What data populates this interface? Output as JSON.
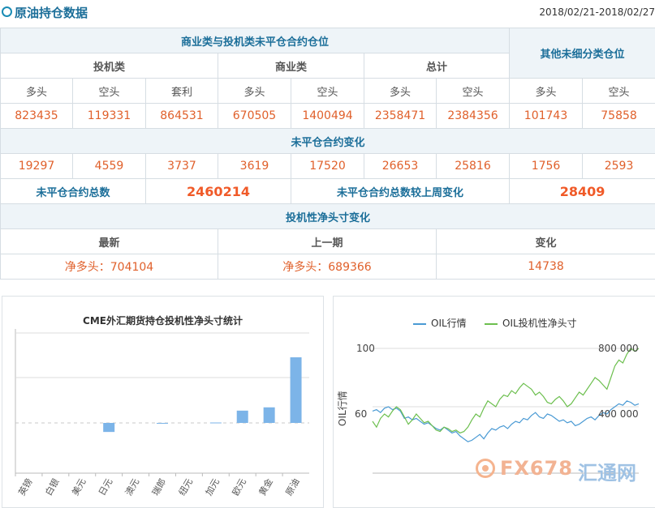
{
  "header": {
    "title": "原油持仓数据",
    "date_range": "2018/02/21-2018/02/27"
  },
  "table": {
    "group_title": "商业类与投机类未平仓合约仓位",
    "other_title": "其他未细分类仓位",
    "groups": [
      "投机类",
      "商业类",
      "总计"
    ],
    "columns": [
      "多头",
      "空头",
      "套利",
      "多头",
      "空头",
      "多头",
      "空头",
      "多头",
      "空头"
    ],
    "positions": [
      "823435",
      "119331",
      "864531",
      "670505",
      "1400494",
      "2358471",
      "2384356",
      "101743",
      "75858"
    ],
    "change_title": "未平仓合约变化",
    "changes": [
      "19297",
      "4559",
      "3737",
      "3619",
      "17520",
      "26653",
      "25816",
      "1756",
      "2593"
    ],
    "total_label": "未平仓合约总数",
    "total_value": "2460214",
    "weekly_change_label": "未平仓合约总数较上周变化",
    "weekly_change_value": "28409",
    "net_title": "投机性净头寸变化",
    "net_headers": [
      "最新",
      "上一期",
      "变化"
    ],
    "net_values": [
      "净多头：704104",
      "净多头：689366",
      "14738"
    ]
  },
  "chart_data": [
    {
      "type": "bar",
      "title": "CME外汇期货持仓投机性净头寸统计",
      "categories": [
        "英镑",
        "白银",
        "美元",
        "日元",
        "澳元",
        "瑞郎",
        "纽元",
        "加元",
        "欧元",
        "黄金",
        "原油"
      ],
      "values": [
        0,
        0,
        0,
        -110000,
        0,
        -8000,
        0,
        5000,
        150000,
        190000,
        800000
      ],
      "xlabel": "",
      "ylabel": "",
      "grid": true,
      "bar_color": "#7cb4e8"
    },
    {
      "type": "line",
      "legend": [
        "OIL行情",
        "OIL投机性净头寸"
      ],
      "left_axis_name": "OIL行情",
      "left_ticks": [
        "100",
        "60"
      ],
      "right_ticks": [
        "800 000",
        "400 000"
      ],
      "colors": [
        "#4a9ad4",
        "#6cbf4e"
      ],
      "series": [
        {
          "name": "OIL行情",
          "values": [
            57,
            58,
            56,
            59,
            60,
            58,
            59,
            57,
            52,
            53,
            51,
            52,
            50,
            48,
            49,
            47,
            45,
            44,
            46,
            44,
            42,
            43,
            40,
            38,
            36,
            37,
            39,
            41,
            38,
            42,
            45,
            44,
            46,
            47,
            45,
            48,
            50,
            49,
            52,
            51,
            54,
            56,
            53,
            52,
            55,
            54,
            52,
            50,
            51,
            49,
            50,
            47,
            48,
            50,
            52,
            53,
            51,
            54,
            56,
            55,
            58,
            60,
            62,
            61,
            64,
            63,
            61,
            62
          ]
        },
        {
          "name": "OIL投机性净头寸",
          "values": [
            300000,
            260000,
            320000,
            350000,
            330000,
            370000,
            400000,
            380000,
            330000,
            280000,
            310000,
            350000,
            320000,
            290000,
            300000,
            270000,
            240000,
            230000,
            260000,
            250000,
            230000,
            240000,
            220000,
            230000,
            260000,
            310000,
            350000,
            330000,
            390000,
            440000,
            420000,
            400000,
            450000,
            480000,
            470000,
            510000,
            490000,
            530000,
            560000,
            540000,
            520000,
            480000,
            500000,
            470000,
            430000,
            420000,
            450000,
            470000,
            440000,
            400000,
            420000,
            460000,
            500000,
            480000,
            520000,
            560000,
            600000,
            580000,
            550000,
            520000,
            600000,
            680000,
            720000,
            700000,
            760000,
            800000,
            780000,
            800000
          ]
        }
      ]
    }
  ],
  "watermark": {
    "brand": "FX678",
    "suffix": "汇通网"
  }
}
